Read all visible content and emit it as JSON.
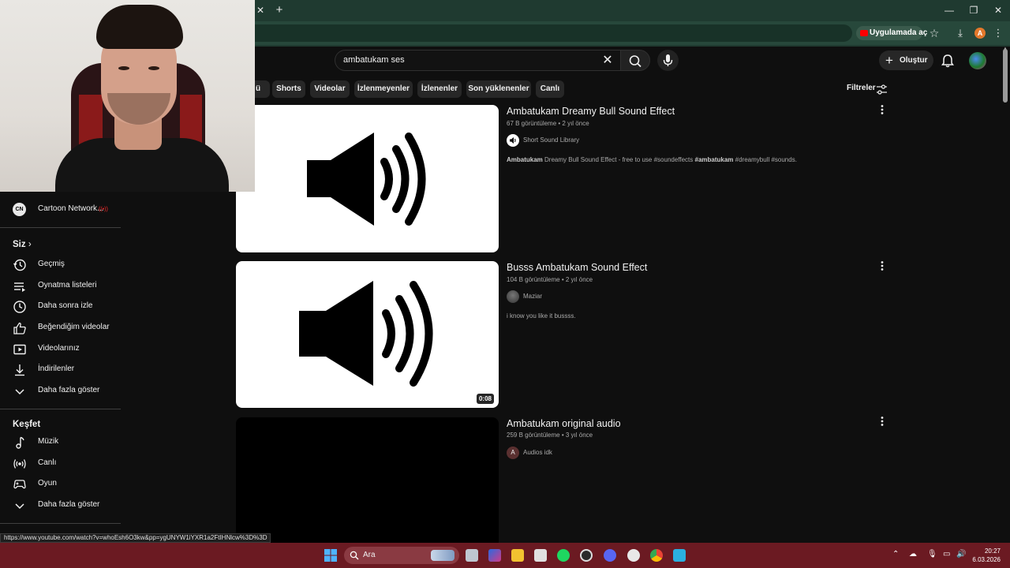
{
  "browser": {
    "open_in_app_label": "Uygulamada aç",
    "profile_initial": "A"
  },
  "search": {
    "query": "ambatukam ses"
  },
  "header": {
    "create_label": "Oluştur"
  },
  "chips": [
    {
      "label": "ü"
    },
    {
      "label": "Shorts"
    },
    {
      "label": "Videolar"
    },
    {
      "label": "İzlenmeyenler"
    },
    {
      "label": "İzlenenler"
    },
    {
      "label": "Son yüklenenler"
    },
    {
      "label": "Canlı"
    }
  ],
  "filters_label": "Filtreler",
  "sidebar": {
    "subscription": {
      "label": "Cartoon Network...",
      "avatar_text": "CN",
      "live": "((•))"
    },
    "you_heading": "Siz",
    "you_items": [
      {
        "label": "Geçmiş",
        "icon": "history-icon"
      },
      {
        "label": "Oynatma listeleri",
        "icon": "playlist-icon"
      },
      {
        "label": "Daha sonra izle",
        "icon": "clock-icon"
      },
      {
        "label": "Beğendiğim videolar",
        "icon": "thumbs-up-icon"
      },
      {
        "label": "Videolarınız",
        "icon": "video-icon"
      },
      {
        "label": "İndirilenler",
        "icon": "download-icon"
      },
      {
        "label": "Daha fazla göster",
        "icon": "chevron-down-icon"
      }
    ],
    "explore_heading": "Keşfet",
    "explore_items": [
      {
        "label": "Müzik",
        "icon": "music-note-icon"
      },
      {
        "label": "Canlı",
        "icon": "live-icon"
      },
      {
        "label": "Oyun",
        "icon": "gamepad-icon"
      },
      {
        "label": "Daha fazla göster",
        "icon": "chevron-down-icon"
      }
    ]
  },
  "results": [
    {
      "title": "Ambatukam Dreamy Bull Sound Effect",
      "meta": "67 B görüntüleme • 2 yıl önce",
      "channel": "Short Sound Library",
      "desc_bold": "Ambatukam",
      "desc_mid": " Dreamy Bull Sound Effect - free to use #soundeffects ",
      "desc_bold2": "#ambatukam",
      "desc_end": " #dreamybull #sounds."
    },
    {
      "title": "Busss Ambatukam Sound Effect",
      "meta": "104 B görüntüleme • 2 yıl önce",
      "channel": "Maziar",
      "desc": "i know you like it bussss.",
      "duration": "0:08"
    },
    {
      "title": "Ambatukam original audio",
      "meta": "259 B görüntüleme • 3 yıl önce",
      "channel": "Audios idk",
      "channel_initial": "A"
    }
  ],
  "status_url": "https://www.youtube.com/watch?v=whoEsh6O3kw&pp=ygUNYW1iYXR1a2FtIHNlcw%3D%3D",
  "taskbar": {
    "search_placeholder": "Ara",
    "time": "20:27",
    "date": "6.03.2026"
  },
  "colors": {
    "background": "#0f0f0f",
    "taskbar": "#6b1a22",
    "chrome": "#27483b",
    "brand_red": "#ff0000"
  }
}
